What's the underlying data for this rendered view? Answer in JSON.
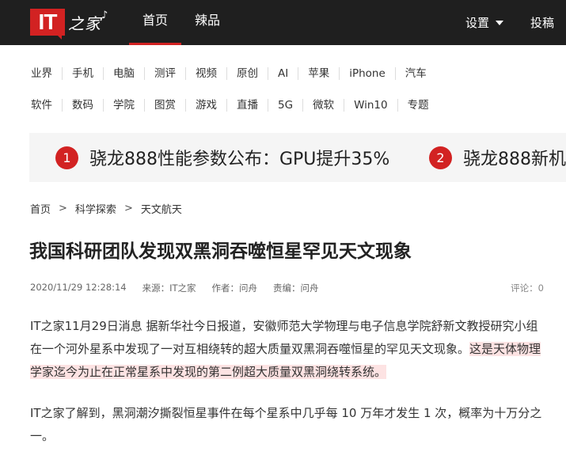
{
  "header": {
    "logo_text": "IT",
    "logo_suffix": "之家",
    "logo_note": "♪",
    "tabs": [
      "首页",
      "辣品"
    ],
    "settings_label": "设置",
    "submit_label": "投稿"
  },
  "categories": {
    "row1": [
      "业界",
      "手机",
      "电脑",
      "测评",
      "视频",
      "原创",
      "AI",
      "苹果",
      "iPhone",
      "汽车"
    ],
    "row2": [
      "软件",
      "数码",
      "学院",
      "图赏",
      "游戏",
      "直播",
      "5G",
      "微软",
      "Win10",
      "专题"
    ]
  },
  "hot": [
    {
      "rank": "1",
      "text": "骁龙888性能参数公布：GPU提升35%"
    },
    {
      "rank": "2",
      "text": "骁龙888新机"
    }
  ],
  "breadcrumb": {
    "items": [
      "首页",
      "科学探索",
      "天文航天"
    ],
    "separator": ">"
  },
  "article": {
    "title": "我国科研团队发现双黑洞吞噬恒星罕见天文现象",
    "date": "2020/11/29 12:28:14",
    "source": "来源：IT之家",
    "author": "作者：问舟",
    "editor": "责编：问舟",
    "comments": "评论：0",
    "p1_normal": "IT之家11月29日消息 据新华社今日报道，安徽师范大学物理与电子信息学院舒新文教授研究小组在一个河外星系中发现了一对互相绕转的超大质量双黑洞吞噬恒星的罕见天文现象。",
    "p1_highlight": "这是天体物理学家迄今为止在正常星系中发现的第二例超大质量双黑洞绕转系统。",
    "p2": "IT之家了解到，黑洞潮汐撕裂恒星事件在每个星系中几乎每 10 万年才发生 1 次，概率为十万分之一。"
  },
  "colors": {
    "accent": "#d22222",
    "topbar": "#1f1f1f",
    "highlight": "#fde3e3"
  }
}
